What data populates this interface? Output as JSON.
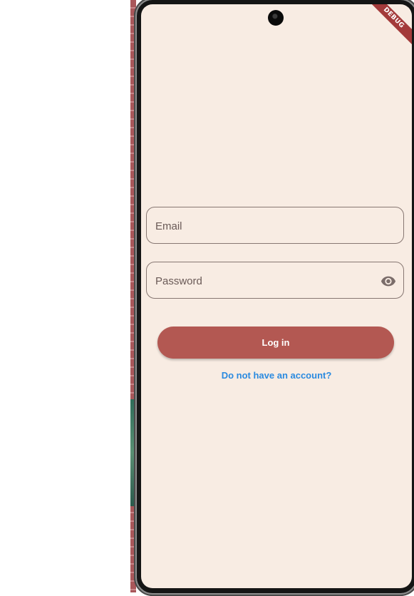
{
  "app": {
    "debug_banner": "DEBUG"
  },
  "login_form": {
    "email_placeholder": "Email",
    "email_value": "",
    "password_placeholder": "Password",
    "password_value": "",
    "password_toggle_icon": "eye-icon",
    "login_label": "Log in",
    "signup_link_label": "Do not have an account?"
  },
  "colors": {
    "background": "#f8ece3",
    "primary_button": "#b35852",
    "link": "#2a8ae0",
    "field_border": "#877772"
  }
}
